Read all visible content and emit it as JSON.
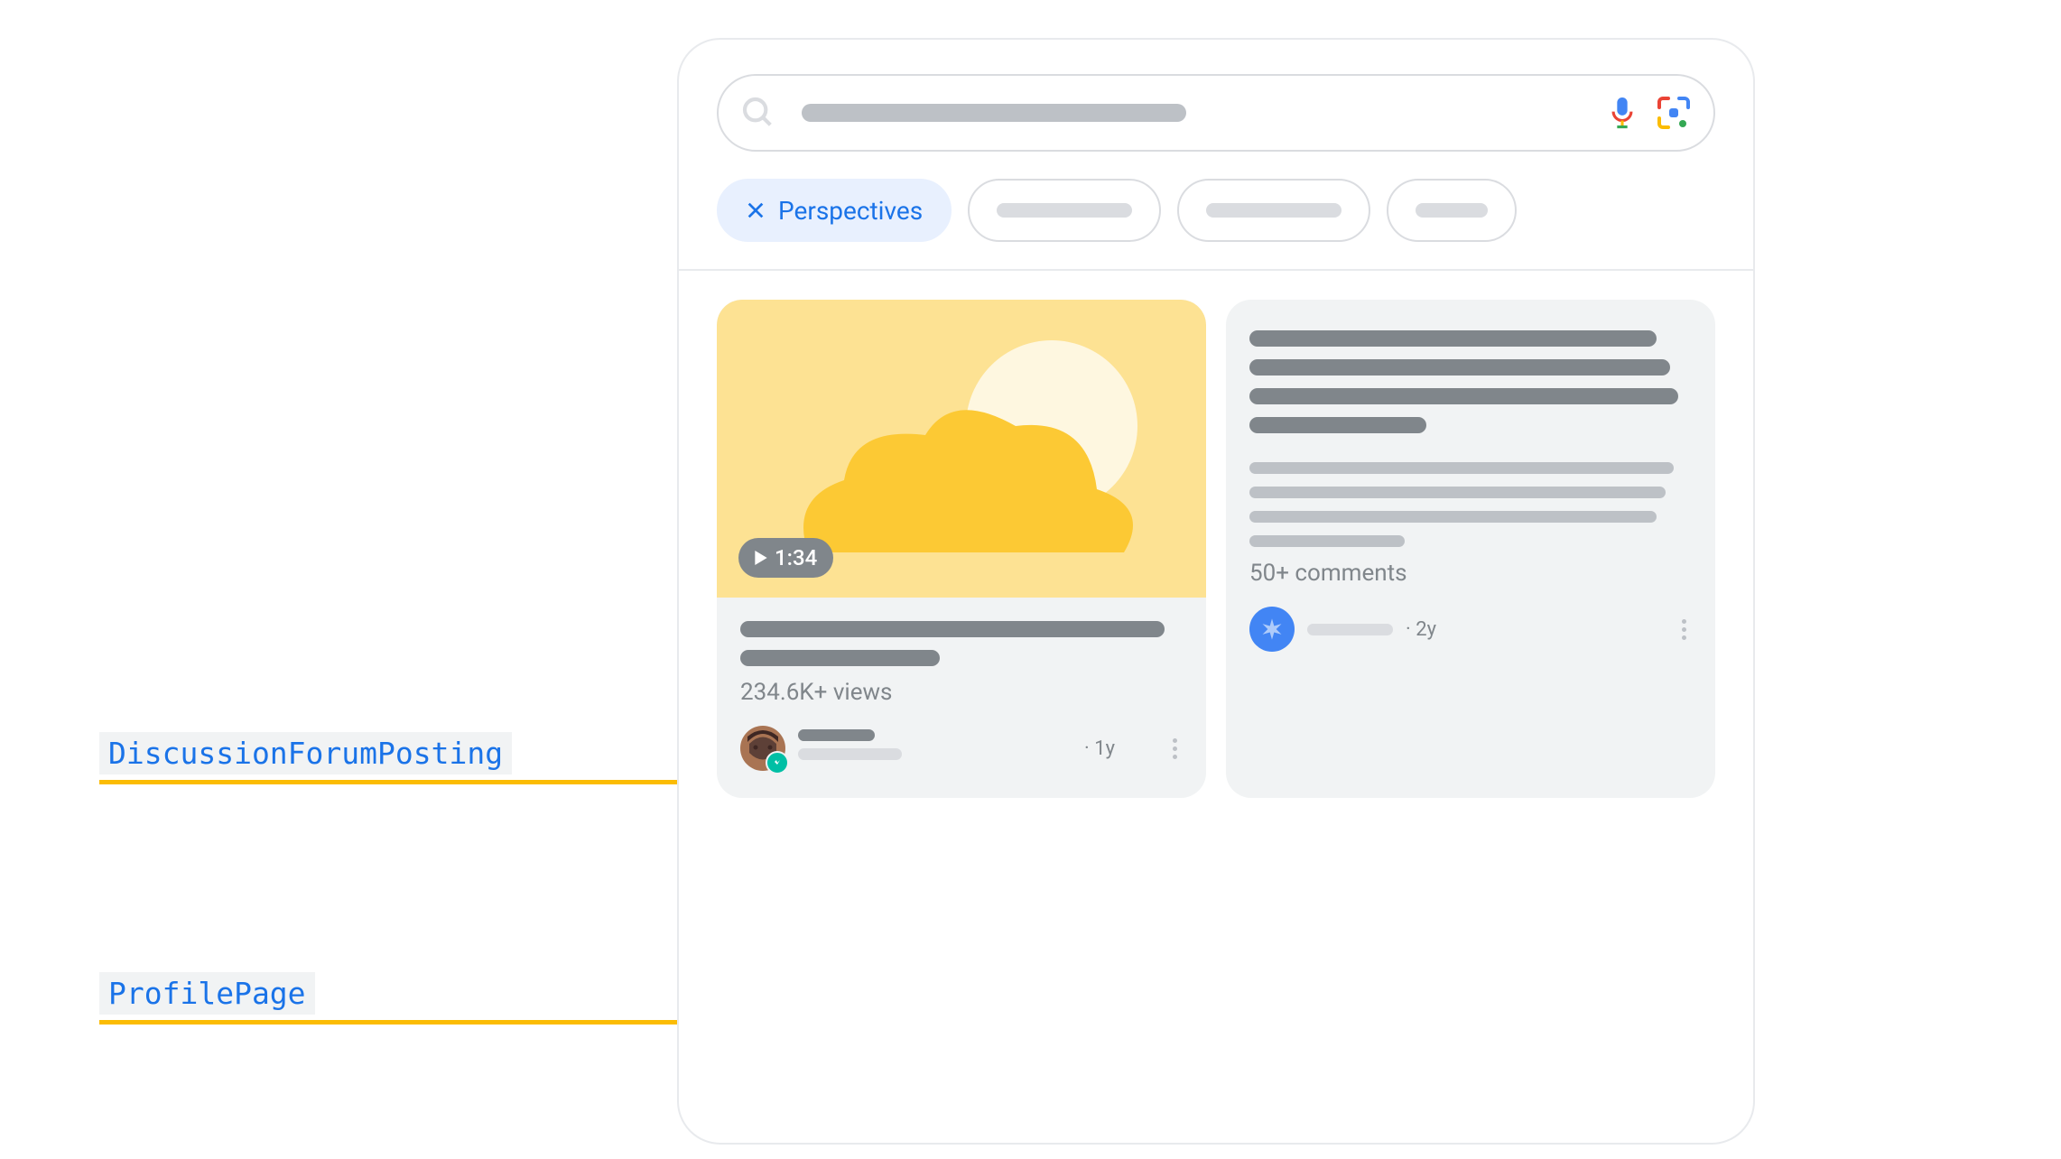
{
  "annotations": {
    "discussion": "DiscussionForumPosting",
    "profile": "ProfilePage"
  },
  "chips": {
    "active": "Perspectives"
  },
  "cards": {
    "video": {
      "duration": "1:34",
      "views": "234.6K+ views",
      "age": "1y"
    },
    "post": {
      "comments": "50+ comments",
      "age": "2y"
    }
  }
}
